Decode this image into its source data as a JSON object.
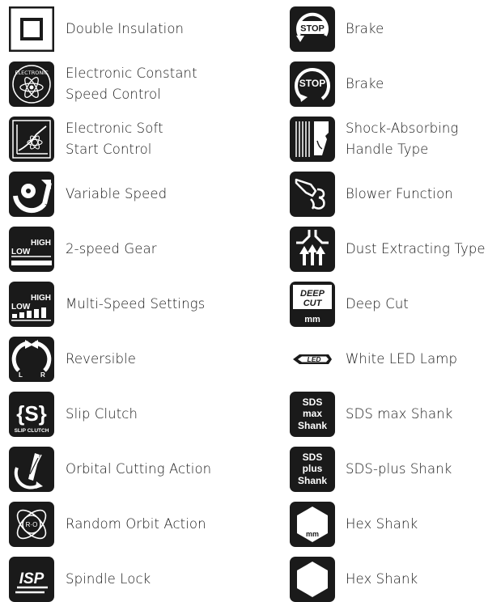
{
  "left": {
    "items": [
      {
        "icon": "double-insulation-icon",
        "line1": "Double Insulation",
        "line2": ""
      },
      {
        "icon": "electronic-constant-speed-icon",
        "line1": "Electronic Constant",
        "line2": "Speed Control",
        "icon_text": "ELECTRONIC"
      },
      {
        "icon": "electronic-soft-start-icon",
        "line1": "Electronic Soft",
        "line2": "Start Control"
      },
      {
        "icon": "variable-speed-icon",
        "line1": "Variable Speed",
        "line2": ""
      },
      {
        "icon": "two-speed-gear-icon",
        "line1": "2-speed Gear",
        "line2": "",
        "icon_low": "LOW",
        "icon_high": "HIGH"
      },
      {
        "icon": "multi-speed-icon",
        "line1": "Multi-Speed Settings",
        "line2": "",
        "icon_low": "LOW",
        "icon_high": "HIGH"
      },
      {
        "icon": "reversible-icon",
        "line1": "Reversible",
        "line2": "",
        "icon_l": "L",
        "icon_r": "R"
      },
      {
        "icon": "slip-clutch-icon",
        "line1": "Slip Clutch",
        "line2": "",
        "icon_s": "{S}",
        "icon_caption": "SLIP CLUTCH"
      },
      {
        "icon": "orbital-cutting-icon",
        "line1": "Orbital Cutting Action",
        "line2": ""
      },
      {
        "icon": "random-orbit-icon",
        "line1": "Random Orbit Action",
        "line2": "",
        "icon_text": "R·O"
      },
      {
        "icon": "spindle-lock-icon",
        "line1": "Spindle Lock",
        "line2": "",
        "icon_text": "ISP"
      }
    ]
  },
  "right": {
    "items": [
      {
        "icon": "brake-stop-icon",
        "line1": "Brake",
        "line2": "",
        "icon_text": "STOP"
      },
      {
        "icon": "brake-stop-circle-icon",
        "line1": "Brake",
        "line2": "",
        "icon_text": "STOP"
      },
      {
        "icon": "shock-absorbing-handle-icon",
        "line1": "Shock-Absorbing",
        "line2": "Handle Type"
      },
      {
        "icon": "blower-function-icon",
        "line1": "Blower Function",
        "line2": ""
      },
      {
        "icon": "dust-extracting-icon",
        "line1": "Dust Extracting Type",
        "line2": ""
      },
      {
        "icon": "deep-cut-icon",
        "line1": "Deep Cut",
        "line2": "",
        "icon_top": "DEEP",
        "icon_mid": "CUT",
        "icon_bottom": "mm"
      },
      {
        "icon": "led-lamp-icon",
        "line1": "White LED Lamp",
        "line2": "",
        "icon_text": "LED"
      },
      {
        "icon": "sds-max-icon",
        "line1": "SDS max Shank",
        "line2": "",
        "icon_l1": "SDS",
        "icon_l2": "max",
        "icon_l3": "Shank"
      },
      {
        "icon": "sds-plus-icon",
        "line1": "SDS-plus Shank",
        "line2": "",
        "icon_l1": "SDS",
        "icon_l2": "plus",
        "icon_l3": "Shank"
      },
      {
        "icon": "hex-shank-mm-icon",
        "line1": "Hex Shank",
        "line2": "",
        "icon_text": "mm"
      },
      {
        "icon": "hex-shank-icon",
        "line1": "Hex Shank",
        "line2": ""
      }
    ]
  }
}
